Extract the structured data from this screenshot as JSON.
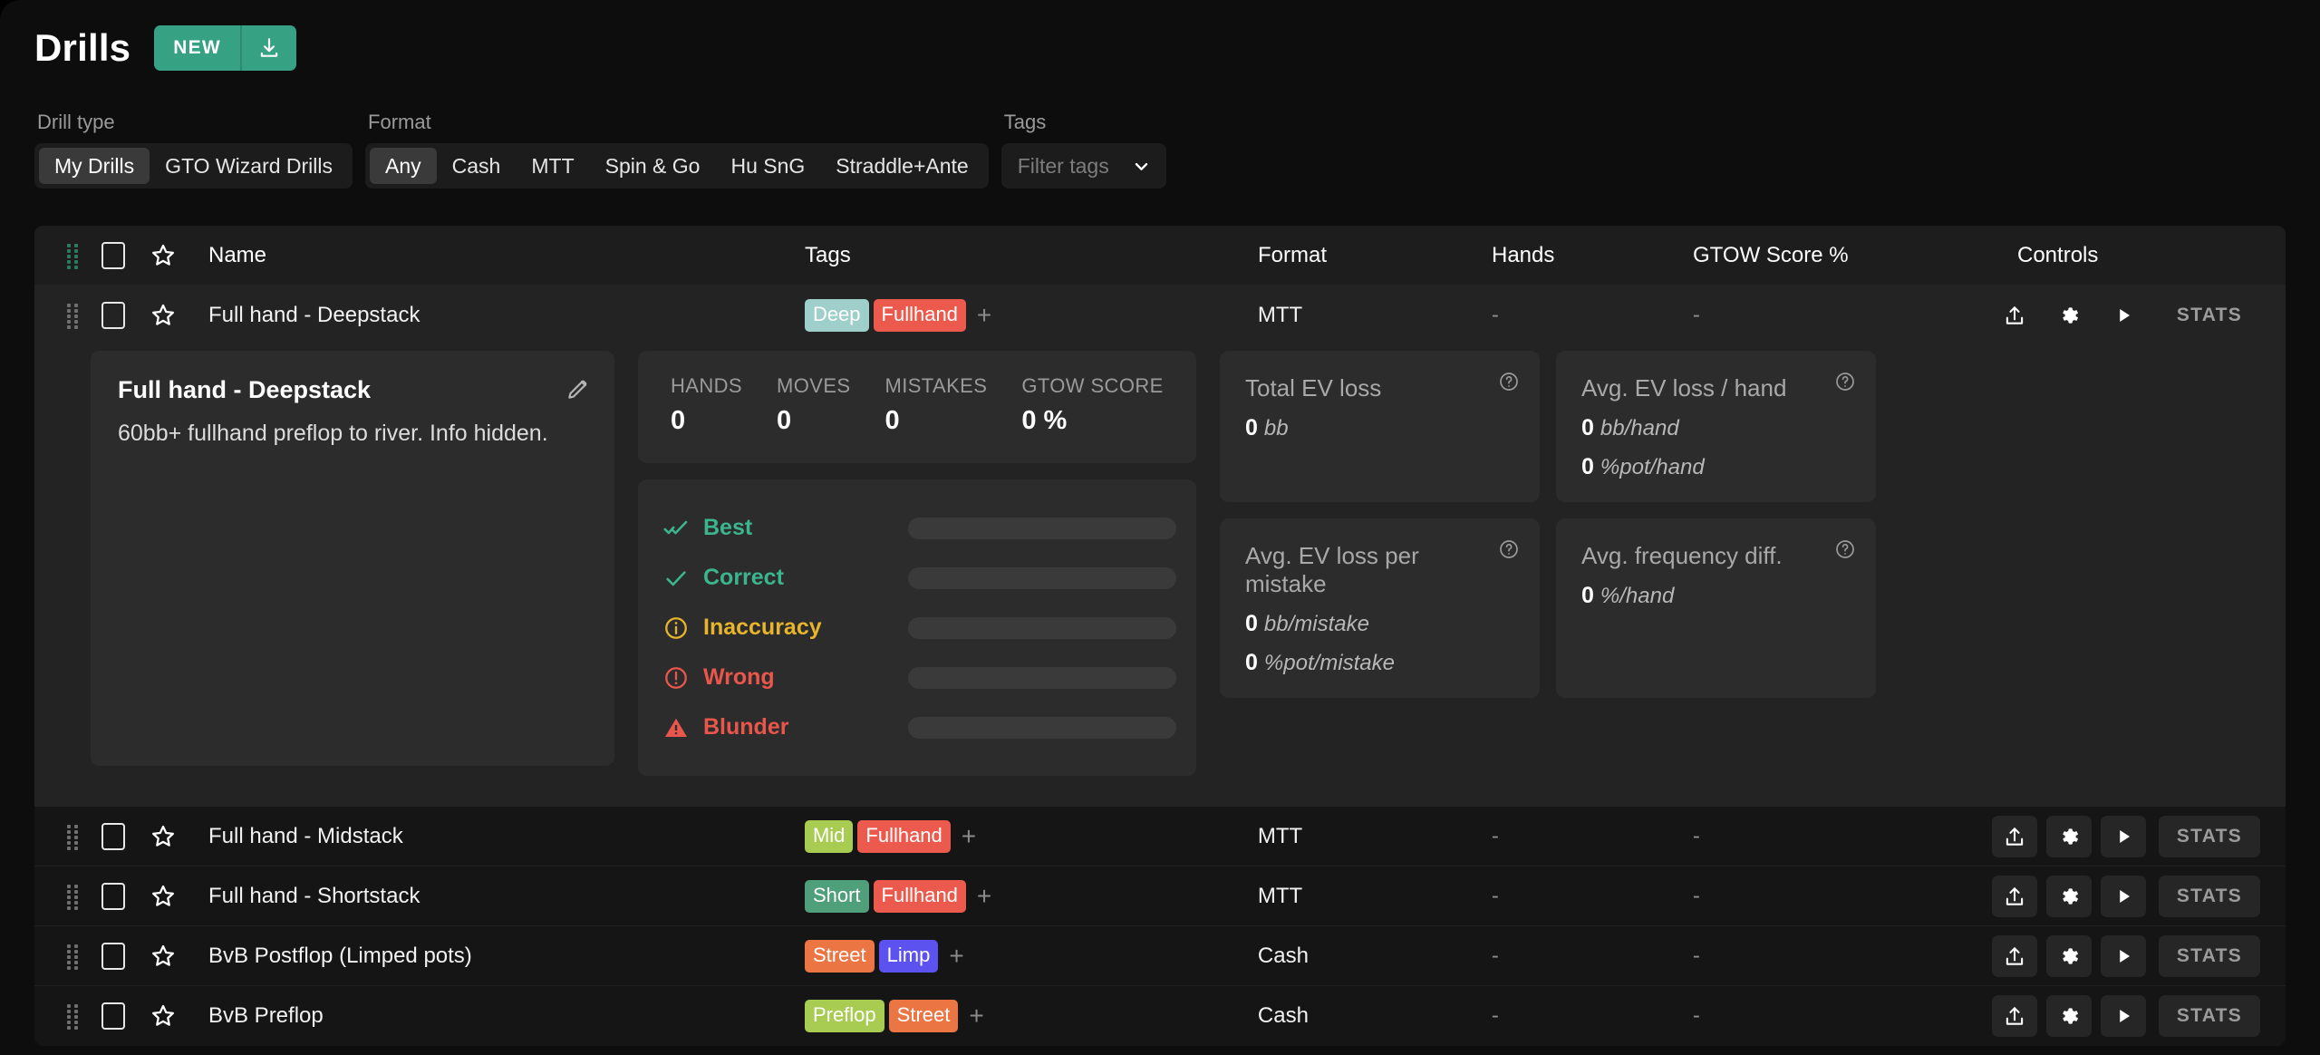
{
  "header": {
    "title": "Drills",
    "new_label": "NEW",
    "download_icon": "download-icon"
  },
  "filters": {
    "drill_type": {
      "label": "Drill type",
      "options": [
        "My Drills",
        "GTO Wizard Drills"
      ],
      "selected": "My Drills"
    },
    "format": {
      "label": "Format",
      "options": [
        "Any",
        "Cash",
        "MTT",
        "Spin & Go",
        "Hu SnG",
        "Straddle+Ante"
      ],
      "selected": "Any"
    },
    "tags": {
      "label": "Tags",
      "placeholder": "Filter tags",
      "chevron_icon": "chevron-down-icon"
    }
  },
  "table": {
    "columns": {
      "name": "Name",
      "tags": "Tags",
      "format": "Format",
      "hands": "Hands",
      "score": "GTOW Score %",
      "controls": "Controls"
    },
    "controls": {
      "export_icon": "export-icon",
      "settings_icon": "gear-icon",
      "play_icon": "play-icon",
      "stats_label": "STATS"
    },
    "tag_add_label": "+",
    "rows": [
      {
        "name": "Full hand - Deepstack",
        "tags": [
          {
            "label": "Deep",
            "color": "#9ecfca",
            "text": "#ffffff"
          },
          {
            "label": "Fullhand",
            "color": "#ec5a4e",
            "text": "#ffffff"
          }
        ],
        "format": "MTT",
        "hands": "-",
        "score": "-",
        "expanded": true
      },
      {
        "name": "Full hand - Midstack",
        "tags": [
          {
            "label": "Mid",
            "color": "#a8cc52",
            "text": "#ffffff"
          },
          {
            "label": "Fullhand",
            "color": "#ec5a4e",
            "text": "#ffffff"
          }
        ],
        "format": "MTT",
        "hands": "-",
        "score": "-",
        "expanded": false
      },
      {
        "name": "Full hand - Shortstack",
        "tags": [
          {
            "label": "Short",
            "color": "#4fa07a",
            "text": "#ffffff"
          },
          {
            "label": "Fullhand",
            "color": "#ec5a4e",
            "text": "#ffffff"
          }
        ],
        "format": "MTT",
        "hands": "-",
        "score": "-",
        "expanded": false
      },
      {
        "name": "BvB Postflop (Limped pots)",
        "tags": [
          {
            "label": "Street",
            "color": "#ec7544",
            "text": "#ffffff"
          },
          {
            "label": "Limp",
            "color": "#5b52f0",
            "text": "#ffffff"
          }
        ],
        "format": "Cash",
        "hands": "-",
        "score": "-",
        "expanded": false
      },
      {
        "name": "BvB Preflop",
        "tags": [
          {
            "label": "Preflop",
            "color": "#a8cc52",
            "text": "#ffffff"
          },
          {
            "label": "Street",
            "color": "#ec7544",
            "text": "#ffffff"
          }
        ],
        "format": "Cash",
        "hands": "-",
        "score": "-",
        "expanded": false
      }
    ]
  },
  "detail": {
    "info": {
      "title": "Full hand - Deepstack",
      "description": "60bb+ fullhand preflop to river. Info hidden.",
      "edit_icon": "pencil-icon"
    },
    "counts": [
      {
        "label": "HANDS",
        "value": "0"
      },
      {
        "label": "MOVES",
        "value": "0"
      },
      {
        "label": "MISTAKES",
        "value": "0"
      },
      {
        "label": "GTOW SCORE",
        "value": "0 %"
      }
    ],
    "quality": [
      {
        "label": "Best",
        "color": "#3bb58e",
        "icon": "double-check-icon",
        "bar_pct": 0
      },
      {
        "label": "Correct",
        "color": "#3bb58e",
        "icon": "check-icon",
        "bar_pct": 0
      },
      {
        "label": "Inaccuracy",
        "color": "#e8b42c",
        "icon": "info-circle-icon",
        "bar_pct": 0
      },
      {
        "label": "Wrong",
        "color": "#e8564c",
        "icon": "exclamation-circle-icon",
        "bar_pct": 0
      },
      {
        "label": "Blunder",
        "color": "#e8564c",
        "icon": "warning-triangle-icon",
        "bar_pct": 0
      }
    ],
    "ev_cards": [
      {
        "title": "Total EV loss",
        "help_icon": "help-circle-icon",
        "lines": [
          {
            "value": "0",
            "unit": "bb"
          }
        ]
      },
      {
        "title": "Avg. EV loss / hand",
        "help_icon": "help-circle-icon",
        "lines": [
          {
            "value": "0",
            "unit": "bb/hand"
          },
          {
            "value": "0",
            "unit": "%pot/hand"
          }
        ]
      },
      {
        "title": "Avg. EV loss per mistake",
        "help_icon": "help-circle-icon",
        "lines": [
          {
            "value": "0",
            "unit": "bb/mistake"
          },
          {
            "value": "0",
            "unit": "%pot/mistake"
          }
        ]
      },
      {
        "title": "Avg. frequency diff.",
        "help_icon": "help-circle-icon",
        "lines": [
          {
            "value": "0",
            "unit": "%/hand"
          }
        ]
      }
    ]
  },
  "colors": {
    "accent": "#36a183",
    "panel": "#151515",
    "card": "#2c2c2c"
  }
}
